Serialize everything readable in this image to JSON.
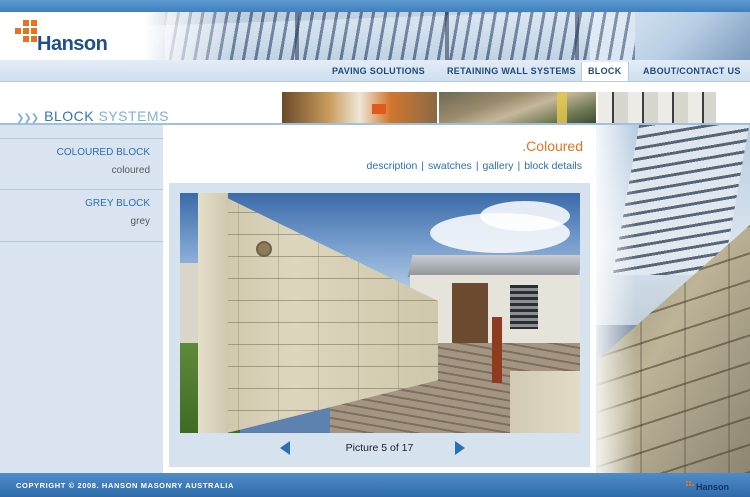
{
  "brand": {
    "name": "Hanson",
    "accent": "#e8731f",
    "primary": "#1f4f8f"
  },
  "nav": {
    "items": [
      {
        "label": "PAVING SOLUTIONS"
      },
      {
        "label": "RETAINING WALL SYSTEMS"
      },
      {
        "label": "BLOCK",
        "active": true
      },
      {
        "label": "ABOUT/CONTACT US"
      }
    ]
  },
  "banner": {
    "title_strong": "BLOCK",
    "title_light": "SYSTEMS"
  },
  "sidebar": {
    "groups": [
      {
        "title": "COLOURED BLOCK",
        "sub": "coloured"
      },
      {
        "title": "GREY BLOCK",
        "sub": "grey"
      }
    ]
  },
  "main": {
    "title": ".Coloured",
    "tabs": [
      "description",
      "swatches",
      "gallery",
      "block details"
    ],
    "pager": {
      "text": "Picture 5 of 17",
      "current": 5,
      "total": 17
    }
  },
  "footer": {
    "copyright": "COPYRIGHT © 2008. HANSON MASONRY AUSTRALIA",
    "logo": "Hanson"
  }
}
